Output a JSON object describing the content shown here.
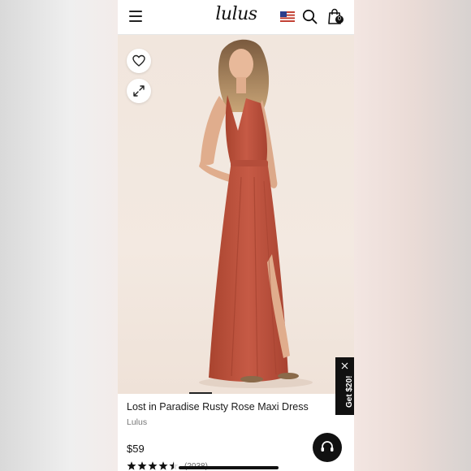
{
  "header": {
    "logo_text": "lulus",
    "cart_count": "0"
  },
  "product": {
    "title": "Lost in Paradise Rusty Rose Maxi Dress",
    "brand": "Lulus",
    "price": "$59",
    "rating_stars": 4.5,
    "review_count": "(2038)"
  },
  "promo": {
    "label": "Get $20!"
  },
  "icons": {
    "menu": "hamburger-menu-icon",
    "flag": "us-flag-icon",
    "search": "search-icon",
    "bag": "shopping-bag-icon",
    "wishlist": "heart-icon",
    "expand": "expand-icon",
    "close": "close-icon",
    "chat": "chat-icon",
    "star": "star-icon"
  },
  "colors": {
    "dress": "#c0513f",
    "background": "#f1e6dd",
    "accent": "#111111"
  }
}
